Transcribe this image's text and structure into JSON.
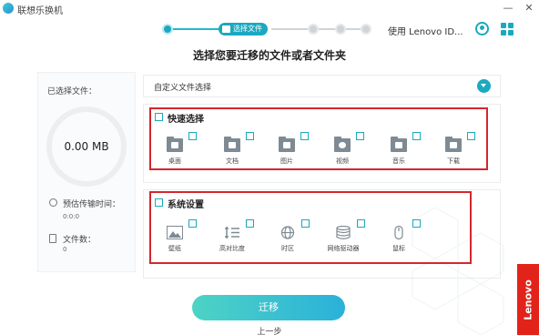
{
  "window": {
    "title": "联想乐换机",
    "min_label": "—",
    "close_label": "✕"
  },
  "stepper": {
    "active_label": "选择文件"
  },
  "account": {
    "label": "使用 Lenovo ID..."
  },
  "heading": "选择您要迁移的文件或者文件夹",
  "summary": {
    "selected_label": "已选择文件：",
    "size_value": "0.00 MB",
    "est_time_label": "预估传输时间：",
    "est_time_value": "0:0:0",
    "file_count_label": "文件数：",
    "file_count_value": "0"
  },
  "custom_select": {
    "label": "自定义文件选择"
  },
  "quick_select": {
    "title": "快速选择",
    "items": [
      {
        "label": "桌面",
        "icon": "desktop-folder-icon"
      },
      {
        "label": "文档",
        "icon": "documents-folder-icon"
      },
      {
        "label": "图片",
        "icon": "pictures-folder-icon"
      },
      {
        "label": "视频",
        "icon": "videos-folder-icon"
      },
      {
        "label": "音乐",
        "icon": "music-folder-icon"
      },
      {
        "label": "下载",
        "icon": "downloads-folder-icon"
      }
    ]
  },
  "system_settings": {
    "title": "系统设置",
    "items": [
      {
        "label": "壁纸",
        "icon": "wallpaper-icon"
      },
      {
        "label": "高对比度",
        "icon": "contrast-icon"
      },
      {
        "label": "时区",
        "icon": "globe-icon"
      },
      {
        "label": "网络驱动器",
        "icon": "network-drive-icon"
      },
      {
        "label": "鼠标",
        "icon": "mouse-icon"
      }
    ]
  },
  "actions": {
    "migrate_label": "迁移",
    "prev_label": "上一步"
  },
  "brand": {
    "text": "Lenovo"
  },
  "colors": {
    "accent": "#1aa9c0",
    "highlight_box": "#d4262d",
    "brand_red": "#e2231a"
  }
}
